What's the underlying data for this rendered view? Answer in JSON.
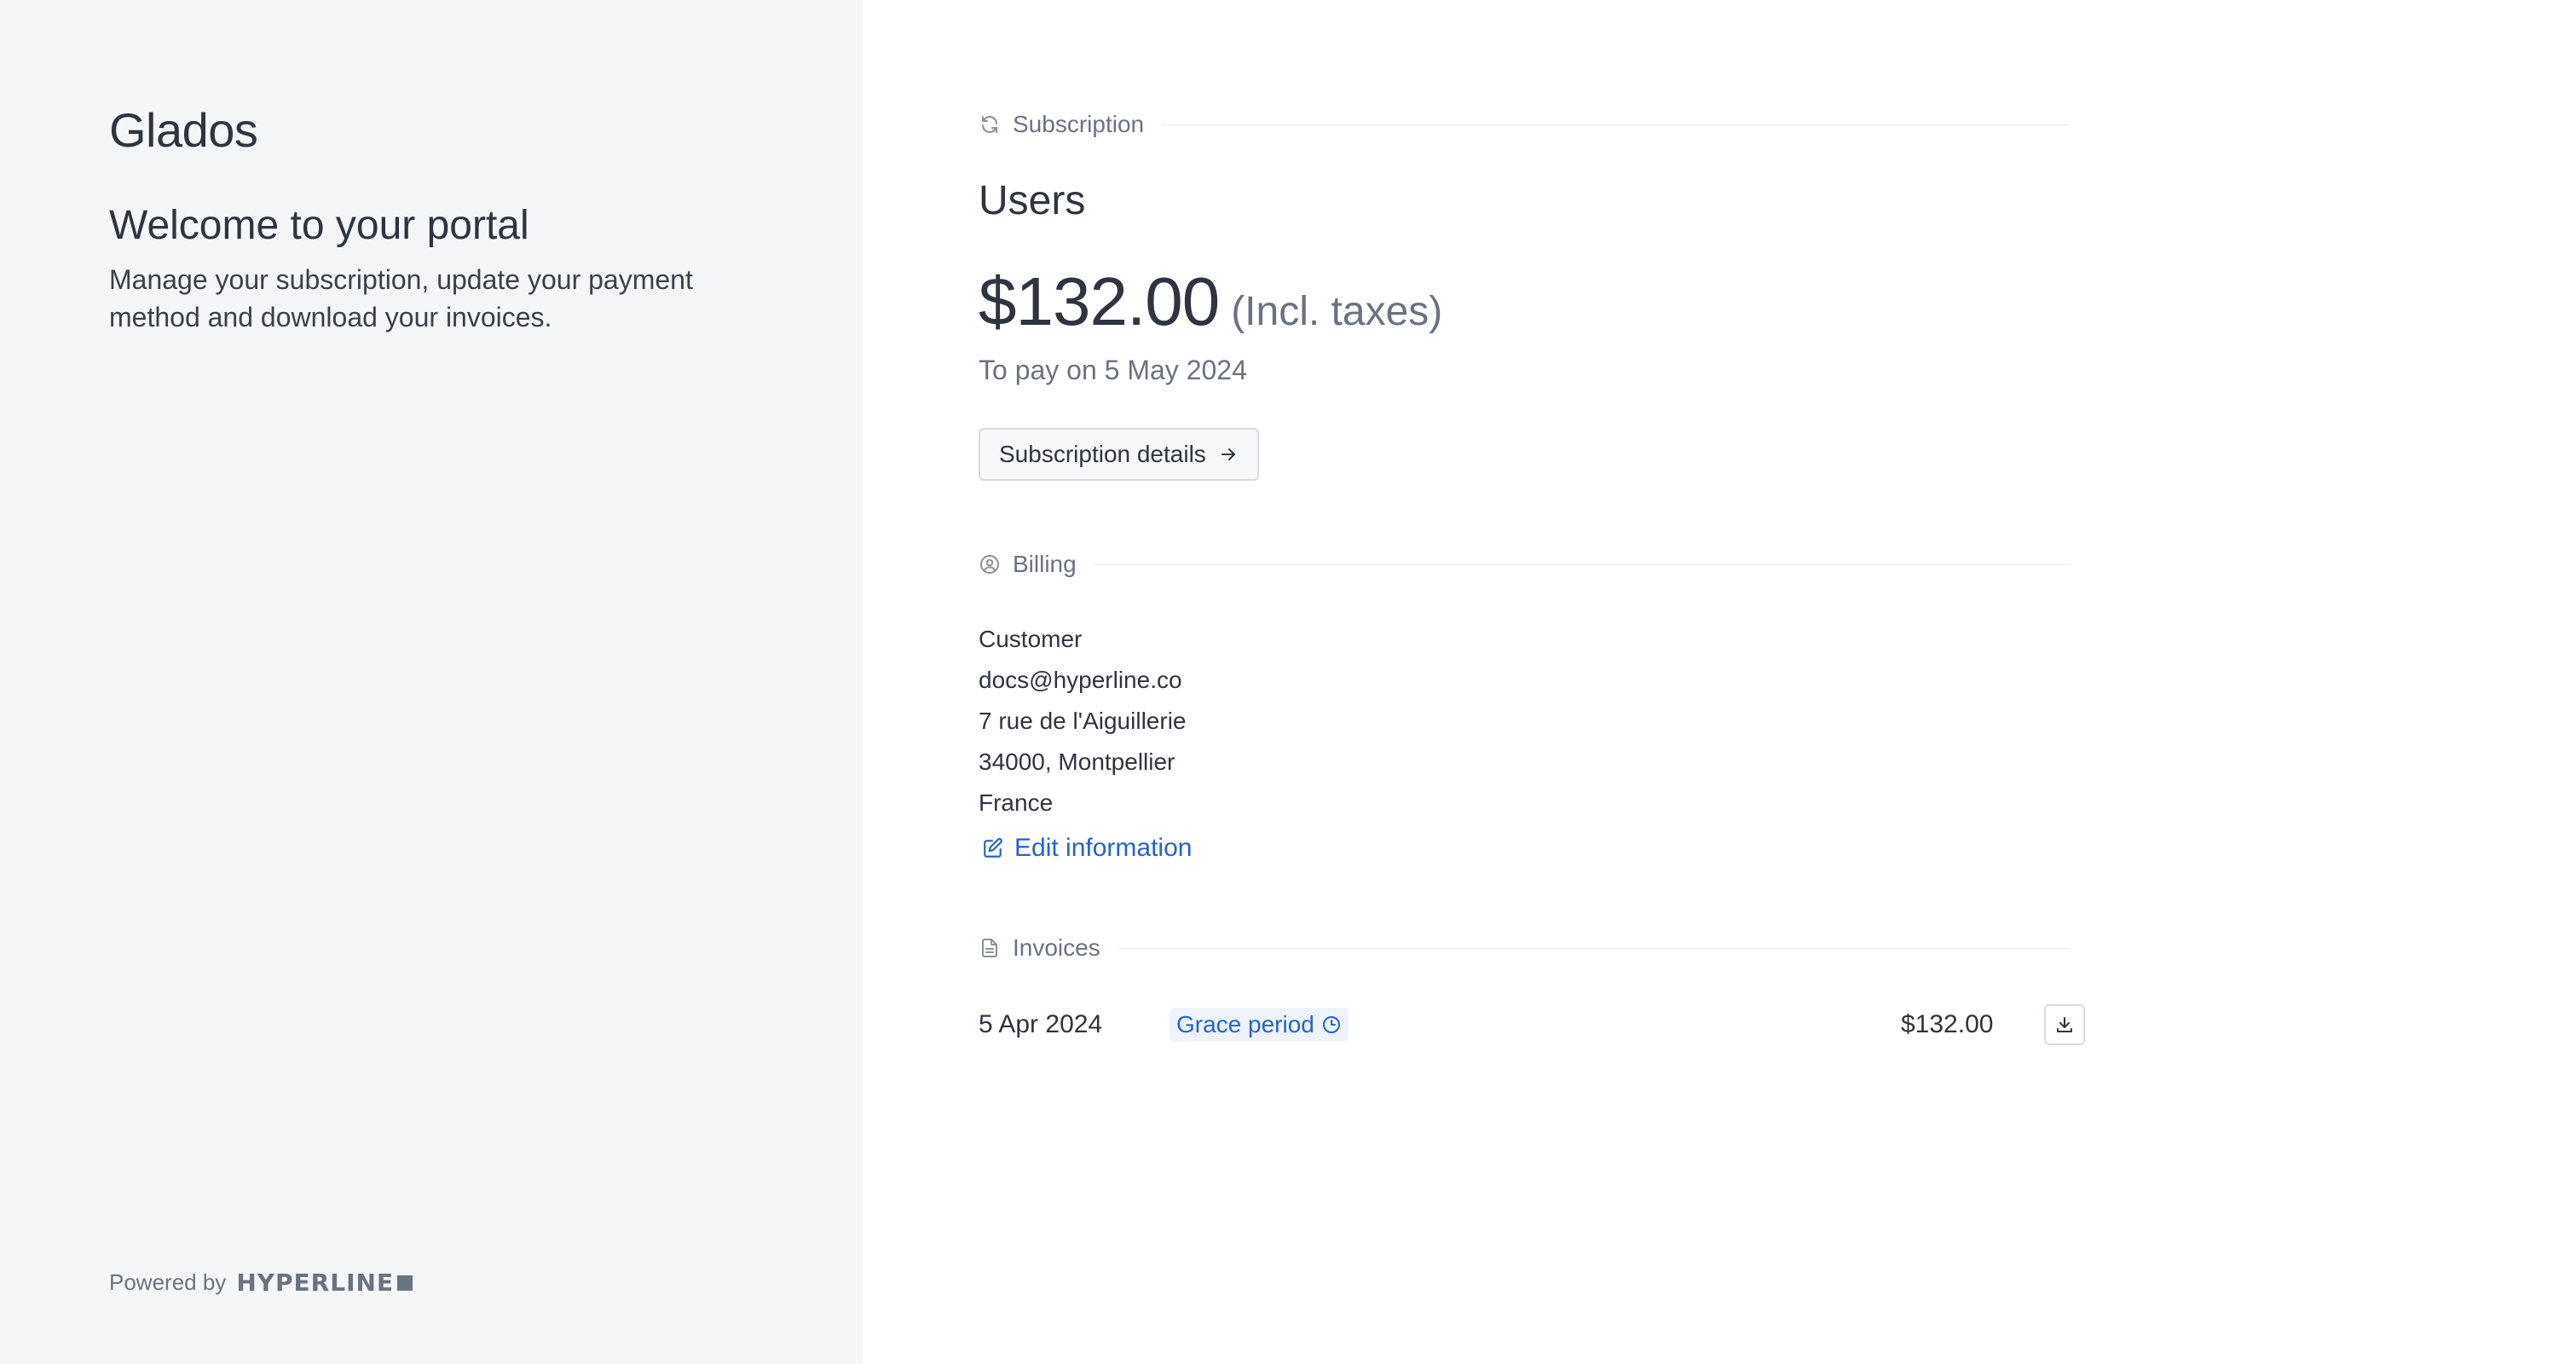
{
  "sidebar": {
    "brand": "Glados",
    "welcome_title": "Welcome to your portal",
    "intro_text": "Manage your subscription, update your payment method and download your invoices.",
    "powered_by_label": "Powered by",
    "powered_by_brand": "HYPERLINE"
  },
  "subscription": {
    "section_label": "Subscription",
    "icon": "refresh-icon",
    "product_name": "Users",
    "price": "$132.00",
    "tax_note": "(Incl. taxes)",
    "due_text": "To pay on 5 May 2024",
    "details_button_label": "Subscription details"
  },
  "billing": {
    "section_label": "Billing",
    "icon": "user-circle-icon",
    "customer_name": "Customer",
    "email": "docs@hyperline.co",
    "address_line": "7 rue de l'Aiguillerie",
    "city_line": "34000, Montpellier",
    "country": "France",
    "edit_link_label": "Edit information"
  },
  "invoices": {
    "section_label": "Invoices",
    "icon": "document-icon",
    "items": [
      {
        "date": "5 Apr 2024",
        "status": "Grace period",
        "amount": "$132.00"
      }
    ]
  },
  "colors": {
    "sidebar_bg": "#f5f6f8",
    "text": "#2f3440",
    "muted": "#6b7280",
    "link": "#2563c9",
    "badge_bg": "#eef3fc"
  }
}
